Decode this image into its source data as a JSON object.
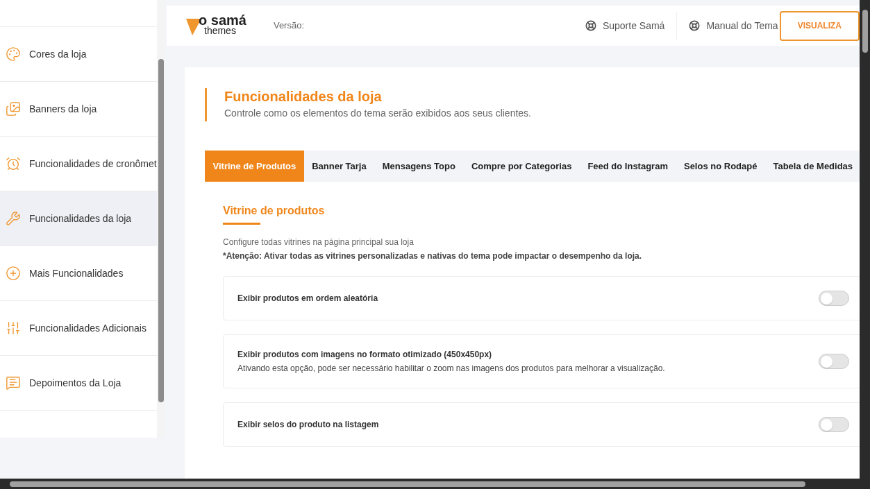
{
  "sidebar": {
    "items": [
      {
        "label": "Cores da loja",
        "selected": false
      },
      {
        "label": "Banners da loja",
        "selected": false
      },
      {
        "label": "Funcionalidades de cronômet",
        "selected": false
      },
      {
        "label": "Funcionalidades da loja",
        "selected": true
      },
      {
        "label": "Mais Funcionalidades",
        "selected": false
      },
      {
        "label": "Funcionalidades Adicionais",
        "selected": false
      },
      {
        "label": "Depoimentos da Loja",
        "selected": false
      }
    ]
  },
  "header": {
    "logo": {
      "name": "o samá",
      "sub": "themes"
    },
    "version_label": "Versão:",
    "links": [
      "Suporte Samá",
      "Manual do Tema"
    ],
    "button": "VISUALIZA"
  },
  "page": {
    "title": "Funcionalidades da loja",
    "subtitle": "Controle como os elementos do tema serão exibidos aos seus clientes."
  },
  "tabs": [
    {
      "label": "Vitrine de Produtos",
      "selected": true
    },
    {
      "label": "Banner Tarja",
      "selected": false
    },
    {
      "label": "Mensagens Topo",
      "selected": false
    },
    {
      "label": "Compre por Categorias",
      "selected": false
    },
    {
      "label": "Feed do Instagram",
      "selected": false
    },
    {
      "label": "Selos no Rodapé",
      "selected": false
    },
    {
      "label": "Tabela de Medidas",
      "selected": false
    }
  ],
  "section": {
    "title": "Vitrine de produtos",
    "description": "Configure todas vitrines na página principal sua loja",
    "warning": "*Atenção: Ativar todas as vitrines personalizadas e nativas do tema pode impactar o desempenho da loja."
  },
  "options": [
    {
      "label": "Exibir produtos em ordem aleatória",
      "on": false
    },
    {
      "label": "Exibir produtos com imagens no formato otimizado (450x450px)",
      "hint": "Ativando esta opção, pode ser necessário habilitar o zoom nas imagens dos produtos para melhorar a visualização.",
      "on": false
    },
    {
      "label": "Exibir selos do produto na listagem",
      "on": false
    }
  ]
}
